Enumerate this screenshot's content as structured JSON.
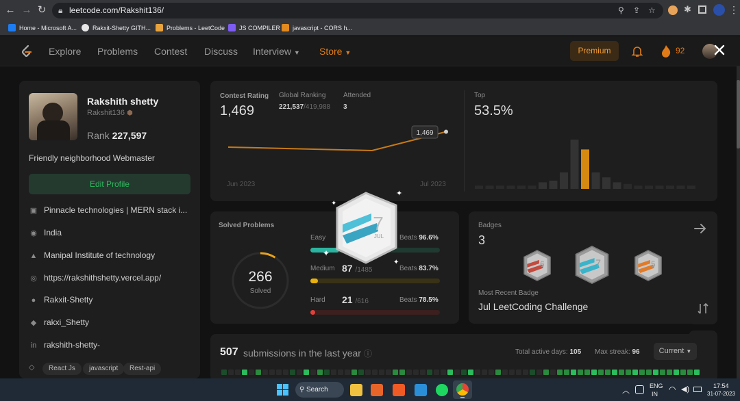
{
  "browser": {
    "url": "leetcode.com/Rakshit136/",
    "bookmarks": [
      {
        "label": "Home - Microsoft A...",
        "color": "#1d7cf2"
      },
      {
        "label": "Rakxit-Shetty GITH...",
        "color": "#e8e8e8"
      },
      {
        "label": "Problems - LeetCode",
        "color": "#e8a33d"
      },
      {
        "label": "JS COMPILER",
        "color": "#7d5cf2"
      },
      {
        "label": "javascript - CORS h...",
        "color": "#e28a1d"
      }
    ]
  },
  "nav": {
    "items": [
      "Explore",
      "Problems",
      "Contest",
      "Discuss",
      "Interview"
    ],
    "store": "Store",
    "premium": "Premium",
    "streak": "92"
  },
  "profile": {
    "name": "Rakshith shetty",
    "handle": "Rakshit136",
    "rank_label": "Rank",
    "rank": "227,597",
    "bio": "Friendly neighborhood Webmaster",
    "edit_button": "Edit Profile",
    "info": [
      {
        "icon": "briefcase-icon",
        "glyph": "▣",
        "text": "Pinnacle technologies | MERN stack i..."
      },
      {
        "icon": "location-icon",
        "glyph": "◉",
        "text": "India"
      },
      {
        "icon": "graduation-cap-icon",
        "glyph": "▲",
        "text": "Manipal Institute of technology"
      },
      {
        "icon": "globe-icon",
        "glyph": "◎",
        "text": "https://rakshithshetty.vercel.app/"
      },
      {
        "icon": "github-icon",
        "glyph": "●",
        "text": "Rakxit-Shetty"
      },
      {
        "icon": "twitter-icon",
        "glyph": "◆",
        "text": "rakxi_Shetty"
      },
      {
        "icon": "linkedin-icon",
        "glyph": "in",
        "text": "rakshith-shetty-"
      }
    ],
    "tags": [
      "React Js",
      "javascript",
      "Rest-api"
    ]
  },
  "contest": {
    "rating_label": "Contest Rating",
    "rating": "1,469",
    "global_label": "Global Ranking",
    "global_rank": "221,537",
    "global_total": "/419,988",
    "attended_label": "Attended",
    "attended": "3",
    "top_label": "Top",
    "top_value": "53.5%",
    "tooltip": "1,469",
    "axis_start": "Jun 2023",
    "axis_end": "Jul 2023"
  },
  "chart_data": [
    {
      "type": "line",
      "x": [
        "Jun 2023",
        "",
        "Jul 2023"
      ],
      "values": [
        1500,
        1490,
        1545
      ],
      "xlabel": "",
      "ylabel": ""
    },
    {
      "type": "bar",
      "values": [
        2,
        2,
        2,
        2,
        2,
        2,
        4,
        5,
        10,
        30,
        24,
        10,
        7,
        4,
        3,
        2,
        2,
        2,
        2,
        2,
        2
      ],
      "highlight_index": 10,
      "xlabel": "",
      "ylabel": ""
    }
  ],
  "solved": {
    "title": "Solved Problems",
    "total": "266",
    "total_label": "Solved",
    "solved_fraction": 0.09,
    "difficulties": [
      {
        "label": "Easy",
        "count": "",
        "total": "",
        "beats_label": "Beats",
        "beats": "96.6%",
        "fraction": 0.22,
        "track": "#1f3a30",
        "fill": "#2bb5a0"
      },
      {
        "label": "Medium",
        "count": "87",
        "total": "/1485",
        "beats_label": "Beats",
        "beats": "83.7%",
        "fraction": 0.06,
        "track": "#3a3216",
        "fill": "#e8b10d"
      },
      {
        "label": "Hard",
        "count": "21",
        "total": "/616",
        "beats_label": "Beats",
        "beats": "78.5%",
        "fraction": 0.034,
        "track": "#3c1f1f",
        "fill": "#e0403c"
      }
    ]
  },
  "badges": {
    "title": "Badges",
    "count": "3",
    "items": [
      {
        "number": "6",
        "month": "JUN",
        "color": "#c24a3e"
      },
      {
        "number": "7",
        "month": "JUL",
        "color": "#3bb3c9"
      },
      {
        "number": "5",
        "month": "MAY",
        "color": "#e07b2a"
      }
    ],
    "recent_label": "Most Recent Badge",
    "recent_name": "Jul LeetCoding Challenge"
  },
  "popup_badge": {
    "number": "7",
    "month": "JUL"
  },
  "submissions": {
    "count": "507",
    "label": "submissions in the last year",
    "active_days_label": "Total active days:",
    "active_days": "105",
    "max_streak_label": "Max streak:",
    "max_streak": "96",
    "current_button": "Current"
  },
  "taskbar": {
    "search": "Search",
    "lang": "ENG",
    "region": "IN",
    "time": "17:54",
    "date": "31-07-2023"
  }
}
